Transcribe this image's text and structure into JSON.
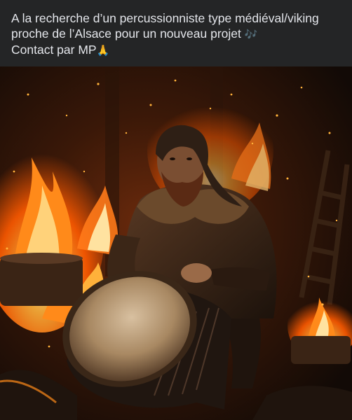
{
  "post": {
    "caption_lines": [
      "A la recherche d’un percussionniste type médiéval/viking",
      "proche de l’Alsace pour un nouveau projet",
      "Contact par MP"
    ],
    "emojis": {
      "music_notes": "🎶",
      "folded_hands": "🙏"
    }
  },
  "image": {
    "subject": "viking-drummer-with-fire",
    "colors": {
      "fire": "#ff7a1a",
      "fire_core": "#ffd27a",
      "ember_glow": "#ff5a00",
      "drum_skin": "#b89a78",
      "background": "#1a0e08"
    }
  }
}
